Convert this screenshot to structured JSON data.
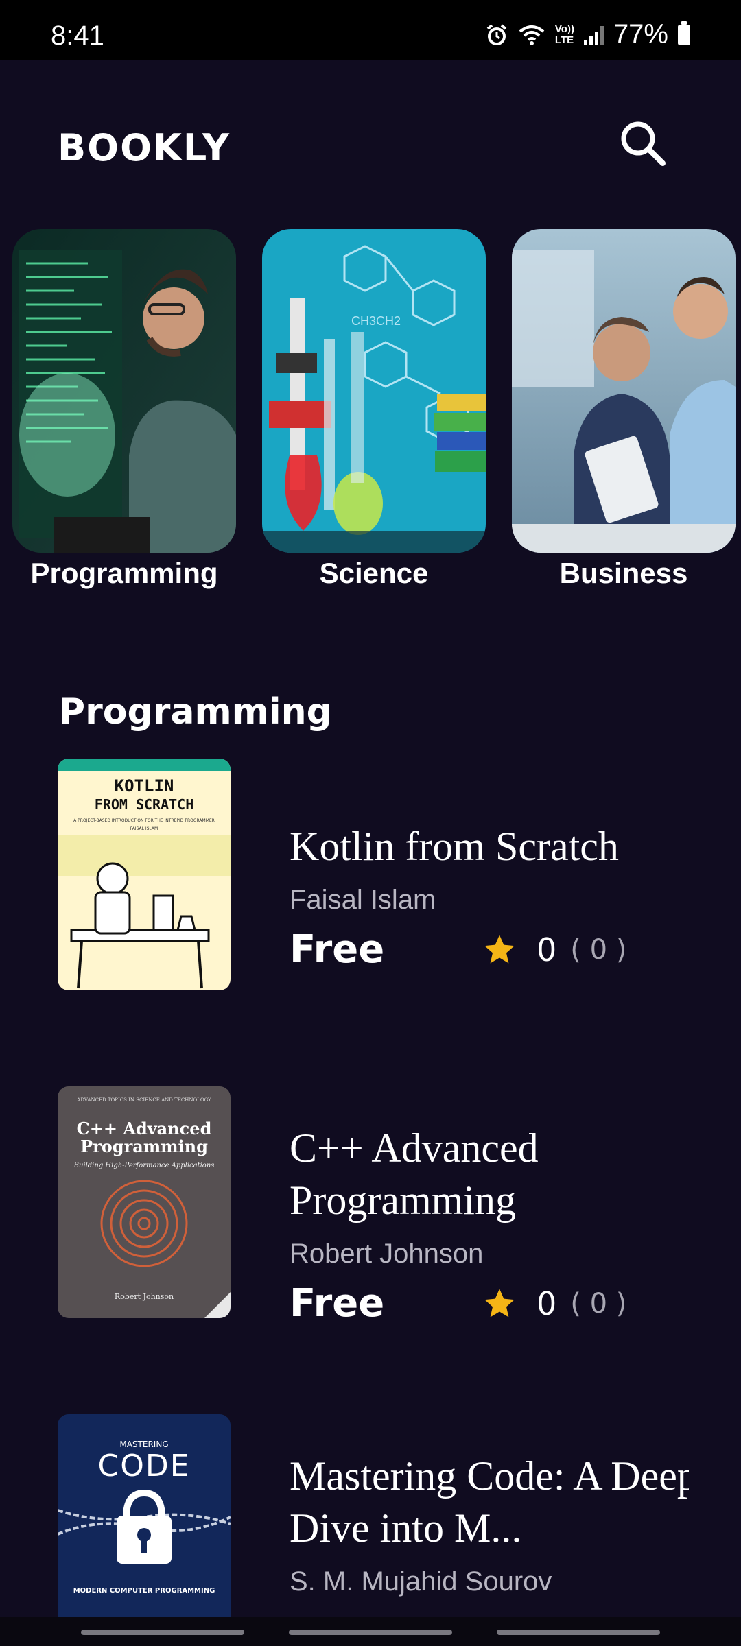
{
  "status": {
    "time": "8:41",
    "battery": "77%",
    "icons": [
      "alarm-icon",
      "wifi-icon",
      "volte-icon",
      "signal-icon",
      "battery-icon"
    ],
    "volte_top": "Vo))",
    "volte_bottom": "LTE"
  },
  "header": {
    "logo": "BOOKLY",
    "search_icon": "search-icon"
  },
  "categories": [
    {
      "label": "Programming"
    },
    {
      "label": "Science"
    },
    {
      "label": "Business"
    }
  ],
  "section": {
    "title": "Programming"
  },
  "books": [
    {
      "title": "Kotlin from Scratch",
      "author": "Faisal Islam",
      "price": "Free",
      "rating": "0",
      "rating_count": "( 0 )",
      "cover": {
        "line1": "KOTLIN",
        "line2": "FROM SCRATCH",
        "subtitle": "A PROJECT-BASED INTRODUCTION FOR THE INTREPID PROGRAMMER",
        "author": "FAISAL ISLAM"
      }
    },
    {
      "title": "C++ Advanced Programming",
      "author": "Robert Johnson",
      "price": "Free",
      "rating": "0",
      "rating_count": "( 0 )",
      "cover": {
        "series": "ADVANCED TOPICS IN SCIENCE AND TECHNOLOGY",
        "line1": "C++ Advanced",
        "line2": "Programming",
        "subtitle": "Building High-Performance Applications",
        "author": "Robert Johnson"
      }
    },
    {
      "title": "Mastering Code: A Deep Dive into M...",
      "author": "S. M. Mujahid Sourov",
      "cover": {
        "line1": "MASTERING",
        "line2": "CODE",
        "subtitle": "MODERN COMPUTER PROGRAMMING"
      }
    }
  ],
  "colors": {
    "background": "#100c20",
    "star": "#f5b516",
    "muted_text": "#b8b6c2"
  }
}
